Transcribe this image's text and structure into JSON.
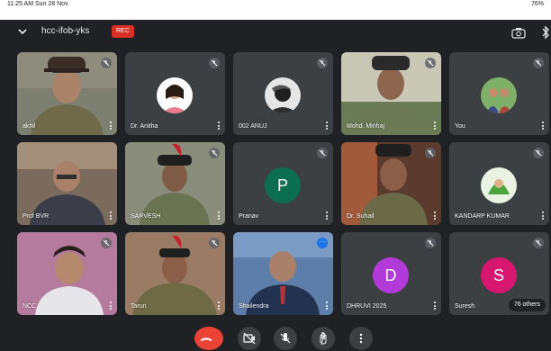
{
  "status_bar": {
    "time": "11:25 AM  Sun 28 Nov",
    "system": "76%"
  },
  "meeting": {
    "code": "hcc-ifob-yks",
    "rec_label": "REC"
  },
  "participants": [
    {
      "name": "akhil",
      "type": "video",
      "bg": "#8a8a7a"
    },
    {
      "name": "Dr. Anitha",
      "type": "avatar",
      "bg": "#3c4043"
    },
    {
      "name": "002 ANUJ",
      "type": "avatar",
      "bg": "#3c4043"
    },
    {
      "name": "Mohd. Minhaj",
      "type": "video",
      "bg": "#6e7763"
    },
    {
      "name": "You",
      "type": "avatar",
      "bg": "#3c4043"
    },
    {
      "name": "Prof BVR",
      "type": "video",
      "bg": "#6a5e52"
    },
    {
      "name": "SARVESH",
      "type": "video",
      "bg": "#6a6d5a"
    },
    {
      "name": "Pranav",
      "type": "letter",
      "letter": "P",
      "color": "#0b6e4f"
    },
    {
      "name": "Dr. Suhail",
      "type": "video",
      "bg": "#7a4c3a"
    },
    {
      "name": "KANDARP KUMAR",
      "type": "avatar",
      "bg": "#3c4043"
    },
    {
      "name": "NCC",
      "type": "video",
      "bg": "#b3789a"
    },
    {
      "name": "Tarun",
      "type": "video",
      "bg": "#8a6e5a"
    },
    {
      "name": "Shailendra",
      "type": "video",
      "bg": "#4a6c8e"
    },
    {
      "name": "DHRUVI 2025",
      "type": "letter",
      "letter": "D",
      "color": "#b23ad9"
    },
    {
      "name": "Suresh",
      "type": "letter",
      "letter": "S",
      "color": "#d6166f",
      "others": "76 others"
    }
  ],
  "controls": {
    "end_call": "end-call",
    "camera": "camera-off",
    "mic": "mic-off",
    "raise_hand": "raise-hand",
    "more": "more-options"
  }
}
